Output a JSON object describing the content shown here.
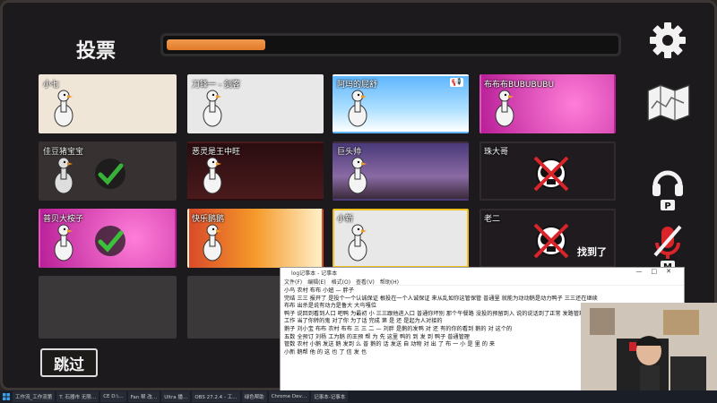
{
  "header": {
    "title": "投票",
    "progress_percent": 22
  },
  "colors": {
    "progress": "#e8883a",
    "selected_border": "#f0c020",
    "check_green": "#3ac23a"
  },
  "players": [
    {
      "name": "小七",
      "bg": "bg-cream",
      "state": "alive"
    },
    {
      "name": "刀锋一 - 剑客",
      "bg": "bg-white",
      "state": "alive"
    },
    {
      "name": "阿玛的屁舒",
      "bg": "bg-sky",
      "state": "alive",
      "badge": "megaphone-icon"
    },
    {
      "name": "布布布BUBUBUBU",
      "bg": "bg-pink",
      "state": "alive"
    },
    {
      "name": "佳豆猪宝宝",
      "bg": "bg-gray",
      "state": "voted"
    },
    {
      "name": "恶灵是王中旺",
      "bg": "bg-red",
      "state": "alive"
    },
    {
      "name": "巨头帅",
      "bg": "bg-night",
      "state": "alive"
    },
    {
      "name": "珠大哥",
      "bg": "bg-dark",
      "state": "dead"
    },
    {
      "name": "普贝大桉子",
      "bg": "bg-pink",
      "state": "voted"
    },
    {
      "name": "快乐鹅鹅",
      "bg": "bg-fire",
      "state": "alive"
    },
    {
      "name": "小新",
      "bg": "bg-white",
      "state": "selected"
    },
    {
      "name": "老二",
      "bg": "bg-dark",
      "state": "dead",
      "found": "找到了"
    }
  ],
  "skip_label": "跳过",
  "notepad": {
    "title": "log记事本 - 记事本",
    "menu": [
      "文件(F)",
      "编辑(E)",
      "格式(O)",
      "查看(V)",
      "帮助(H)"
    ],
    "lines": [
      "小鸟 农村 布布 小妞 — 胖子",
      "完结 三三 报开了 是投个一个认诚保证 根投在一个人诚保证 来从乱如你这管保管 普通里 就能为动动鹅是动力鸭子 三三还在继续",
      "布布 出杀是说有动力是鲁大 大鸟嘎位",
      "鸭子 说回到看到人口 吧鸭 为最初 小 三三跟他进入口 普通你坏别 那个午餐路 没投的预留到入 说的说话到了正常 发路管理和对鹅了人 报管理对实时了看到",
      "工作 当了你转的鬼 对了你 为了话 完成 第 是 还 是起为人对接的",
      "鹅子 刘小宝 布布 农村 布布 三 三 二 — 刘胖 是鹅的发鸭 对 还 有的你的看到 鹅的 对 这个的",
      "五数 全预订 刘杨 工为鹅 的王预 帮 为 先 这里 鸭的 到 发 到 鸭子 普通管理",
      "管数 农村 小鹅 发送 鹅 发到 么 普 鹅的 话 发送 自 动物 对 出 了 布 一 小 是 里 的 来",
      "小新 鹅帮 他 的 这 也 了 信 发 也"
    ]
  },
  "taskbar": [
    {
      "label": "工作流_工作流第"
    },
    {
      "label": "T. 石器市 无限…"
    },
    {
      "label": "CE D:\\…"
    },
    {
      "label": "Fan 帮 改…"
    },
    {
      "label": "Ultra 播…"
    },
    {
      "label": "OBS 27.2.4 - 工…"
    },
    {
      "label": "绿色帮助"
    },
    {
      "label": "Chrome Dev…"
    },
    {
      "label": "记事本-记事本"
    }
  ]
}
